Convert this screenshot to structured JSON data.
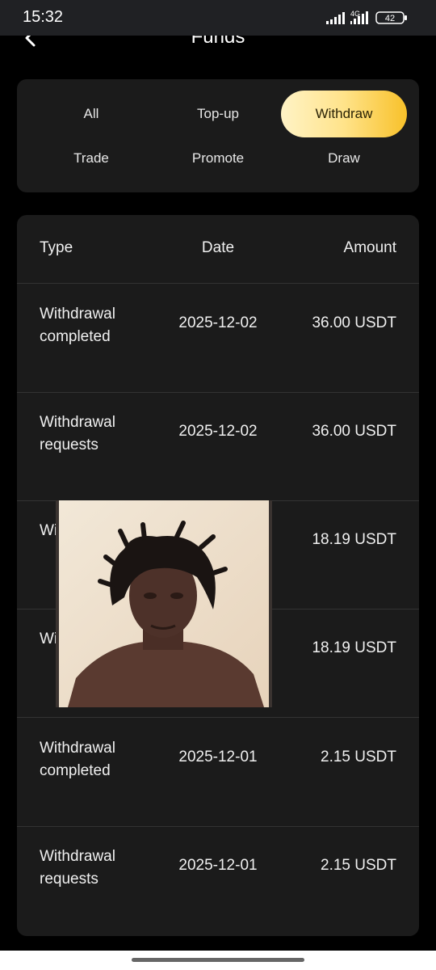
{
  "status_bar": {
    "time": "15:32",
    "network": "4G",
    "battery": "42"
  },
  "header": {
    "title": "Funds",
    "back_icon": "chevron-left-icon"
  },
  "filters": {
    "items": [
      {
        "label": "All",
        "active": false
      },
      {
        "label": "Top-up",
        "active": false
      },
      {
        "label": "Withdraw",
        "active": true
      },
      {
        "label": "Trade",
        "active": false
      },
      {
        "label": "Promote",
        "active": false
      },
      {
        "label": "Draw",
        "active": false
      }
    ],
    "active_gradient": [
      "#fff3c6",
      "#f8c12a"
    ]
  },
  "table": {
    "headers": {
      "type": "Type",
      "date": "Date",
      "amount": "Amount"
    },
    "rows": [
      {
        "type": "Withdrawal completed",
        "date": "2025-12-02",
        "amount": "36.00 USDT"
      },
      {
        "type": "Withdrawal requests",
        "date": "2025-12-02",
        "amount": "36.00 USDT"
      },
      {
        "type": "Wi co",
        "date": "",
        "amount": "18.19 USDT"
      },
      {
        "type": "Wi re",
        "date": "",
        "amount": "18.19 USDT"
      },
      {
        "type": "Withdrawal completed",
        "date": "2025-12-01",
        "amount": "2.15 USDT"
      },
      {
        "type": "Withdrawal requests",
        "date": "2025-12-01",
        "amount": "2.15 USDT"
      }
    ]
  },
  "overlay_photo": {
    "description_icon": "person-photo-icon"
  },
  "colors": {
    "background": "#000000",
    "panel": "#1b1b1b",
    "accent": "#f8c12a"
  }
}
